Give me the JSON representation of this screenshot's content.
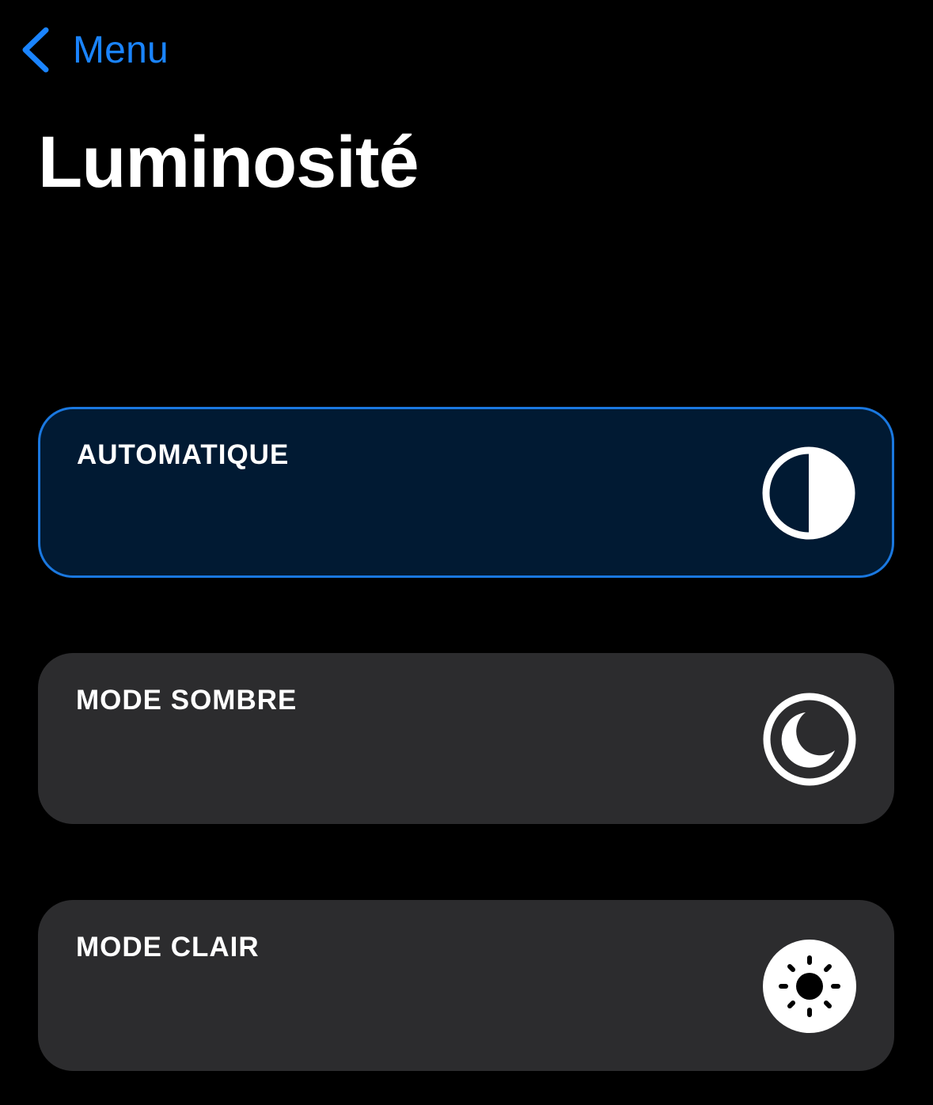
{
  "nav": {
    "back_label": "Menu",
    "accent_color": "#1a84ff",
    "back_icon": "chevron-left-icon"
  },
  "page": {
    "title": "Luminosité"
  },
  "options": [
    {
      "label": "AUTOMATIQUE",
      "icon": "half-circle-icon",
      "selected": true
    },
    {
      "label": "MODE SOMBRE",
      "icon": "moon-icon",
      "selected": false
    },
    {
      "label": "MODE CLAIR",
      "icon": "sun-icon",
      "selected": false
    }
  ],
  "colors": {
    "background": "#000000",
    "card": "#2c2c2e",
    "selected_card": "#011a33",
    "selected_border": "#1a78e0"
  }
}
